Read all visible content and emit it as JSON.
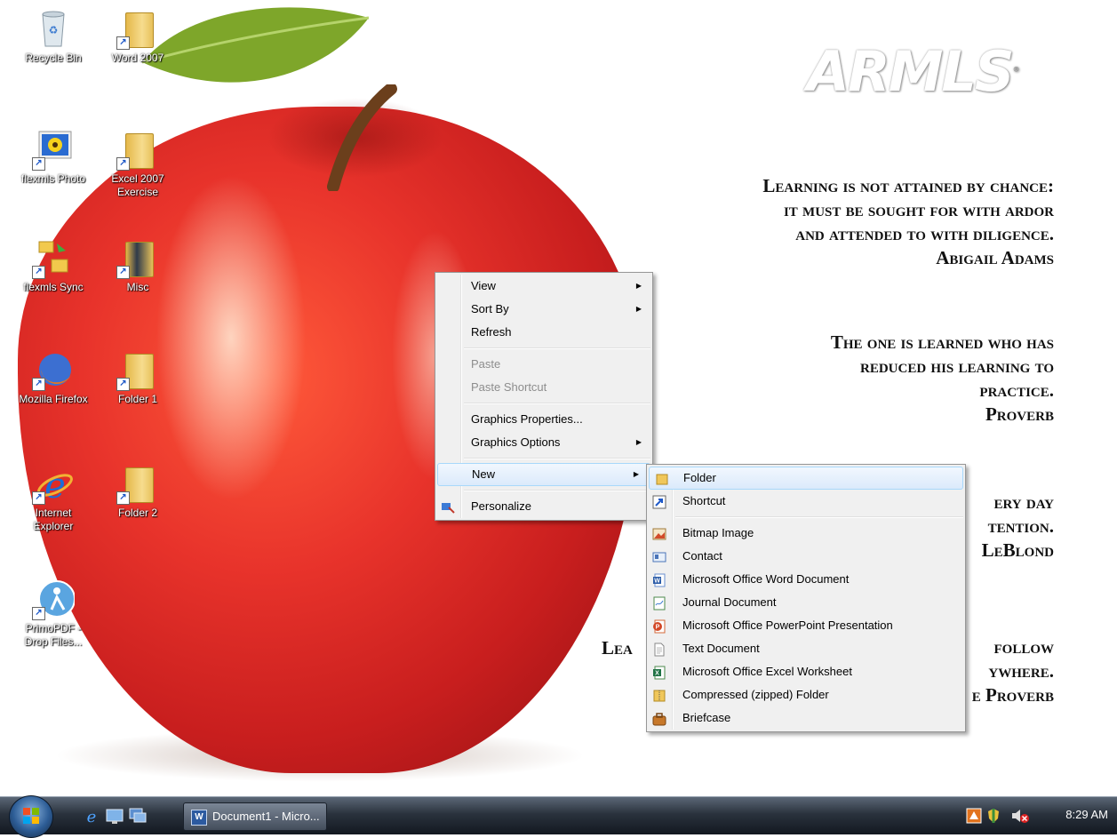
{
  "desktop": {
    "logo": "ARMLS",
    "logo_mark": "®",
    "icons": [
      {
        "label": "Recycle Bin"
      },
      {
        "label": "Word 2007"
      },
      {
        "label": "flexmls Photo"
      },
      {
        "label": "Excel 2007 Exercise"
      },
      {
        "label": "flexmls Sync"
      },
      {
        "label": "Misc"
      },
      {
        "label": "Mozilla Firefox"
      },
      {
        "label": "Folder 1"
      },
      {
        "label": "Internet Explorer"
      },
      {
        "label": "Folder 2"
      },
      {
        "label": "PrimoPDF - Drop Files..."
      }
    ],
    "quotes": [
      {
        "lines": [
          "Learning is not attained by chance:",
          "it must be sought for with ardor",
          "and attended to with diligence."
        ],
        "author": "Abigail Adams"
      },
      {
        "lines": [
          "The one is learned who has",
          "reduced his learning to",
          "practice."
        ],
        "author": "Proverb"
      },
      {
        "lines": [
          "ery day",
          "tention."
        ],
        "author": "LeBlond"
      },
      {
        "left": "Lea",
        "lines": [
          "follow",
          "ywhere."
        ],
        "author": "e Proverb"
      }
    ]
  },
  "context_menu": {
    "items": [
      {
        "label": "View",
        "arrow": "▶"
      },
      {
        "label": "Sort By",
        "arrow": "▶"
      },
      {
        "label": "Refresh"
      },
      {
        "label": "Paste"
      },
      {
        "label": "Paste Shortcut"
      },
      {
        "label": "Graphics Properties..."
      },
      {
        "label": "Graphics Options",
        "arrow": "▶"
      },
      {
        "label": "New",
        "arrow": "▶"
      },
      {
        "label": "Personalize"
      }
    ]
  },
  "new_submenu": {
    "items": [
      {
        "label": "Folder",
        "icon": "folder-icon"
      },
      {
        "label": "Shortcut",
        "icon": "shortcut-icon"
      },
      {
        "label": "Bitmap Image",
        "icon": "bitmap-icon"
      },
      {
        "label": "Contact",
        "icon": "contact-icon"
      },
      {
        "label": "Microsoft Office Word Document",
        "icon": "word-doc-icon"
      },
      {
        "label": "Journal Document",
        "icon": "journal-icon"
      },
      {
        "label": "Microsoft Office PowerPoint Presentation",
        "icon": "powerpoint-icon"
      },
      {
        "label": "Text Document",
        "icon": "text-doc-icon"
      },
      {
        "label": "Microsoft Office Excel Worksheet",
        "icon": "excel-icon"
      },
      {
        "label": "Compressed (zipped) Folder",
        "icon": "zip-folder-icon"
      },
      {
        "label": "Briefcase",
        "icon": "briefcase-icon"
      }
    ]
  },
  "taskbar": {
    "task_label": "Document1 - Micro...",
    "clock": "8:29 AM"
  },
  "colors": {
    "menu_bg": "#f0f0f0",
    "highlight_border": "#a8d8fb",
    "apple_red": "#e8332b"
  }
}
